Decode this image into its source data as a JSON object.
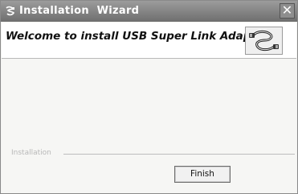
{
  "window": {
    "title": "Installation  Wizard",
    "close_label": "✕"
  },
  "header": {
    "welcome": "Welcome to install USB Super Link Adapter",
    "logo_icon": "usb-link-cable-icon"
  },
  "progress": {
    "label": "Installation"
  },
  "buttons": {
    "finish": "Finish"
  }
}
